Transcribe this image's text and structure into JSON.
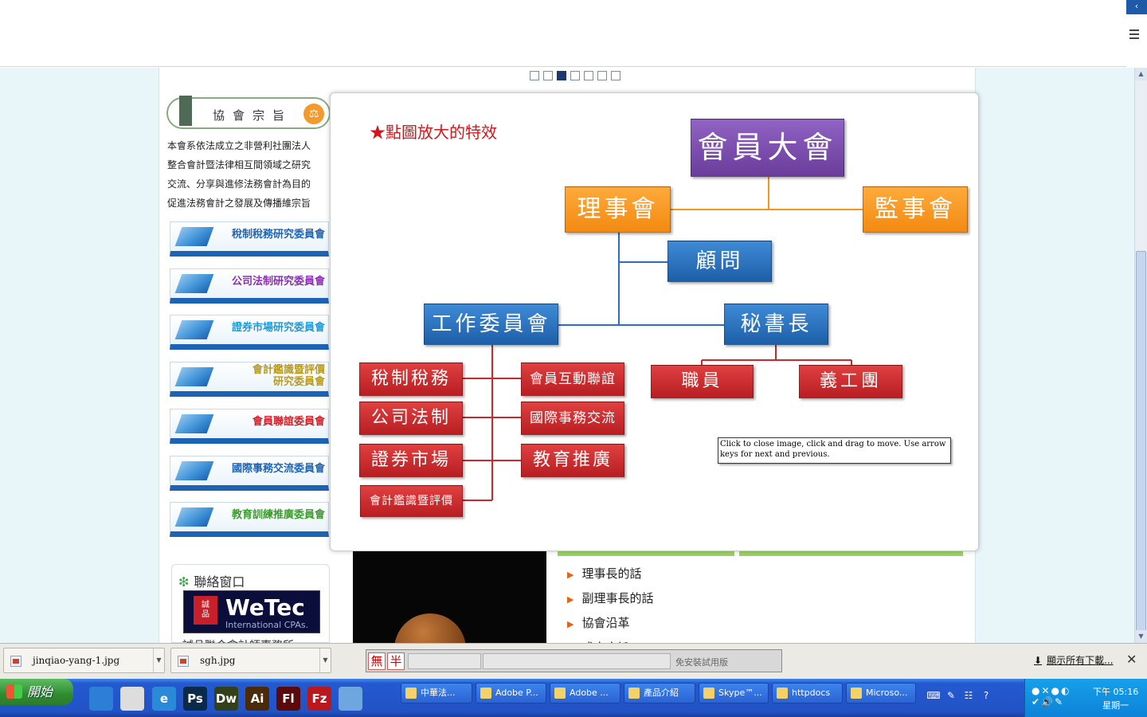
{
  "carousel": {
    "total": 7,
    "active": 3
  },
  "mission": {
    "title": "協會宗旨",
    "lines": [
      "本會系依法成立之非營利社團法人",
      "整合會計暨法律相互間領域之研究",
      "交流、分享與進修法務會計為目的",
      "促進法務會計之發展及傳播維宗旨"
    ]
  },
  "committees": [
    {
      "label": "稅制稅務研究委員會",
      "color": "#1d63b3"
    },
    {
      "label": "公司法制研究委員會",
      "color": "#8b2bb5"
    },
    {
      "label": "證券市場研究委員會",
      "color": "#1a9ad6"
    },
    {
      "label": "會計鑑識暨評價",
      "label2": "研究委員會",
      "color": "#b99a1a"
    },
    {
      "label": "會員聯誼委員會",
      "color": "#d11f2a"
    },
    {
      "label": "國際事務交流委員會",
      "color": "#1d63b3"
    },
    {
      "label": "教育訓練推廣委員會",
      "color": "#3b9b2f"
    }
  ],
  "contact": {
    "title": "聯絡窗口",
    "logo_name": "WeTec",
    "logo_sub": "International CPAs.",
    "logo_mark": "誠品",
    "cut_text": "誠品聯合會計師事務所"
  },
  "links": [
    "理事長的話",
    "副理事長的話",
    "協會沿革",
    "成立宗旨"
  ],
  "lightbox": {
    "effect_title": "★點圖放大的特效",
    "tooltip": "Click to close image, click and drag to move. Use arrow keys for next and previous.",
    "nodes": {
      "assembly": "會員大會",
      "board": "理事會",
      "supervisors": "監事會",
      "advisor": "顧問",
      "work_committee": "工作委員會",
      "secretary": "秘書長",
      "staff": "職員",
      "volunteers": "義工團",
      "tax": "稅制稅務",
      "company_law": "公司法制",
      "securities": "證券市場",
      "accounting": "會計鑑識暨評價",
      "member_relations": "會員互動聯誼",
      "international": "國際事務交流",
      "education": "教育推廣"
    },
    "colors": {
      "purple": "#7a4db1",
      "orange": "#f5961e",
      "blue": "#2b6fbe",
      "red": "#c9282c"
    }
  },
  "download_bar": {
    "items": [
      "jinqiao-yang-1.jpg",
      "sgh.jpg"
    ],
    "show_all": "顯示所有下載...",
    "close": "✕"
  },
  "ime": {
    "btn1": "無",
    "btn2": "半",
    "note": "免安裝試用版"
  },
  "taskbar": {
    "start": "開始",
    "quicklaunch": [
      {
        "icon": "outlook-icon",
        "text": "",
        "color": "#2d7fd6"
      },
      {
        "icon": "chrome-icon",
        "text": "",
        "color": "#ddd"
      },
      {
        "icon": "ie-icon",
        "text": "e",
        "color": "#2a8ad8"
      },
      {
        "icon": "photoshop-icon",
        "text": "Ps",
        "color": "#0b2a4a"
      },
      {
        "icon": "dreamweaver-icon",
        "text": "Dw",
        "color": "#33411a"
      },
      {
        "icon": "illustrator-icon",
        "text": "Ai",
        "color": "#4a2a08"
      },
      {
        "icon": "flash-icon",
        "text": "Fl",
        "color": "#5a0a0a"
      },
      {
        "icon": "filezilla-icon",
        "text": "Fz",
        "color": "#b7191c"
      },
      {
        "icon": "notepad-icon",
        "text": "",
        "color": "#6ea7e0"
      }
    ],
    "tasks": [
      {
        "label": "中華法...",
        "icon": "chrome-icon"
      },
      {
        "label": "Adobe P...",
        "icon": "photoshop-icon"
      },
      {
        "label": "Adobe ...",
        "icon": "dreamweaver-icon"
      },
      {
        "label": "產品介紹",
        "icon": "folder-icon"
      },
      {
        "label": "Skype™...",
        "icon": "skype-icon"
      },
      {
        "label": "httpdocs",
        "icon": "folder-icon"
      },
      {
        "label": "Microso...",
        "icon": "office-icon"
      }
    ],
    "clock_time": "下午 05:16",
    "clock_day": "星期一"
  }
}
